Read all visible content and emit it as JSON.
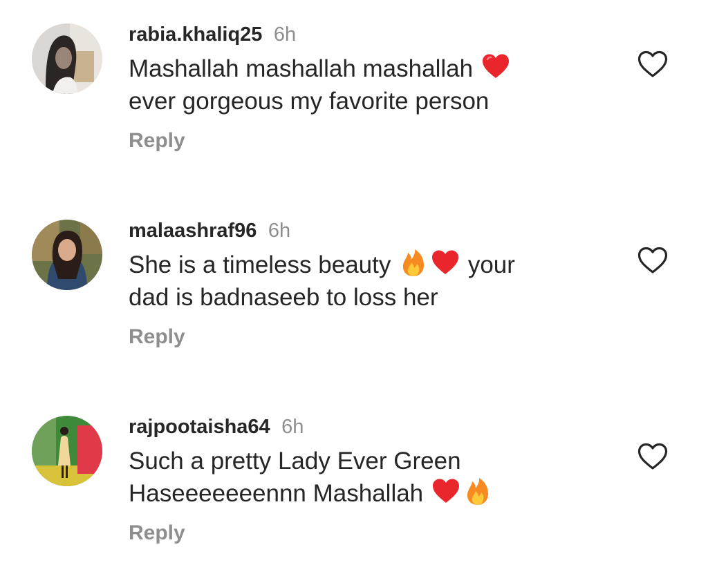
{
  "colors": {
    "text_primary": "#262626",
    "text_secondary": "#8e8e8e",
    "heart_red": "#e8262c",
    "fire_orange": "#f78b22",
    "background": "#ffffff"
  },
  "comments": [
    {
      "username": "rabia.khaliq25",
      "time": "6h",
      "text_segments": [
        "Mashallah mashallah mashallah",
        "ever gorgeous my favorite person"
      ],
      "emojis": [
        "red-heart"
      ],
      "reply_label": "Reply",
      "like_icon": "heart-outline-icon"
    },
    {
      "username": "malaashraf96",
      "time": "6h",
      "text_segments": [
        "She is a timeless beauty",
        "your",
        "dad is badnaseeb to loss her"
      ],
      "emojis": [
        "fire",
        "red-heart"
      ],
      "reply_label": "Reply",
      "like_icon": "heart-outline-icon"
    },
    {
      "username": "rajpootaisha64",
      "time": "6h",
      "text_segments": [
        "Such a pretty Lady Ever Green",
        "Haseeeeeeennn Mashallah"
      ],
      "emojis": [
        "red-heart",
        "fire"
      ],
      "reply_label": "Reply",
      "like_icon": "heart-outline-icon"
    }
  ]
}
